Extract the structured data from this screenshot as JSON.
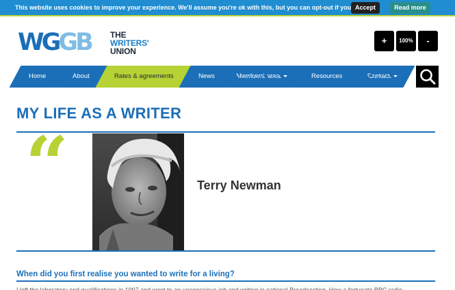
{
  "cookie": {
    "message": "This website uses cookies to improve your experience. We'll assume you're ok with this, but you can opt-out if you wish.",
    "accept_label": "Accept",
    "read_more_label": "Read more"
  },
  "header": {
    "logo_mark_1": "WG",
    "logo_mark_2": "GB",
    "logo_text_line1": "THE",
    "logo_text_line2": "WRITERS'",
    "logo_text_line3": "UNION",
    "zoom_in_label": "+",
    "zoom_level": "100%",
    "zoom_out_label": "-"
  },
  "nav": {
    "items": [
      {
        "label": "Home"
      },
      {
        "label": "About"
      },
      {
        "label": "Rates & agreements"
      },
      {
        "label": "News"
      },
      {
        "label": "Members' area"
      },
      {
        "label": "Resources"
      },
      {
        "label": "Contact"
      }
    ]
  },
  "page": {
    "title": "MY LIFE AS A WRITER",
    "quote_glyph": "“",
    "writer_name": "Terry Newman",
    "question": "When did you first realise you wanted to write for a living?",
    "answer": "I left the laboratory and qualifications in 1997 and went to an unconscious job and writing in national Broadcasting. How a fortunate BBC radio"
  },
  "colors": {
    "brand_blue": "#1b6fb8",
    "brand_green": "#b6d234",
    "cookie_bar": "#1f8dd0"
  }
}
